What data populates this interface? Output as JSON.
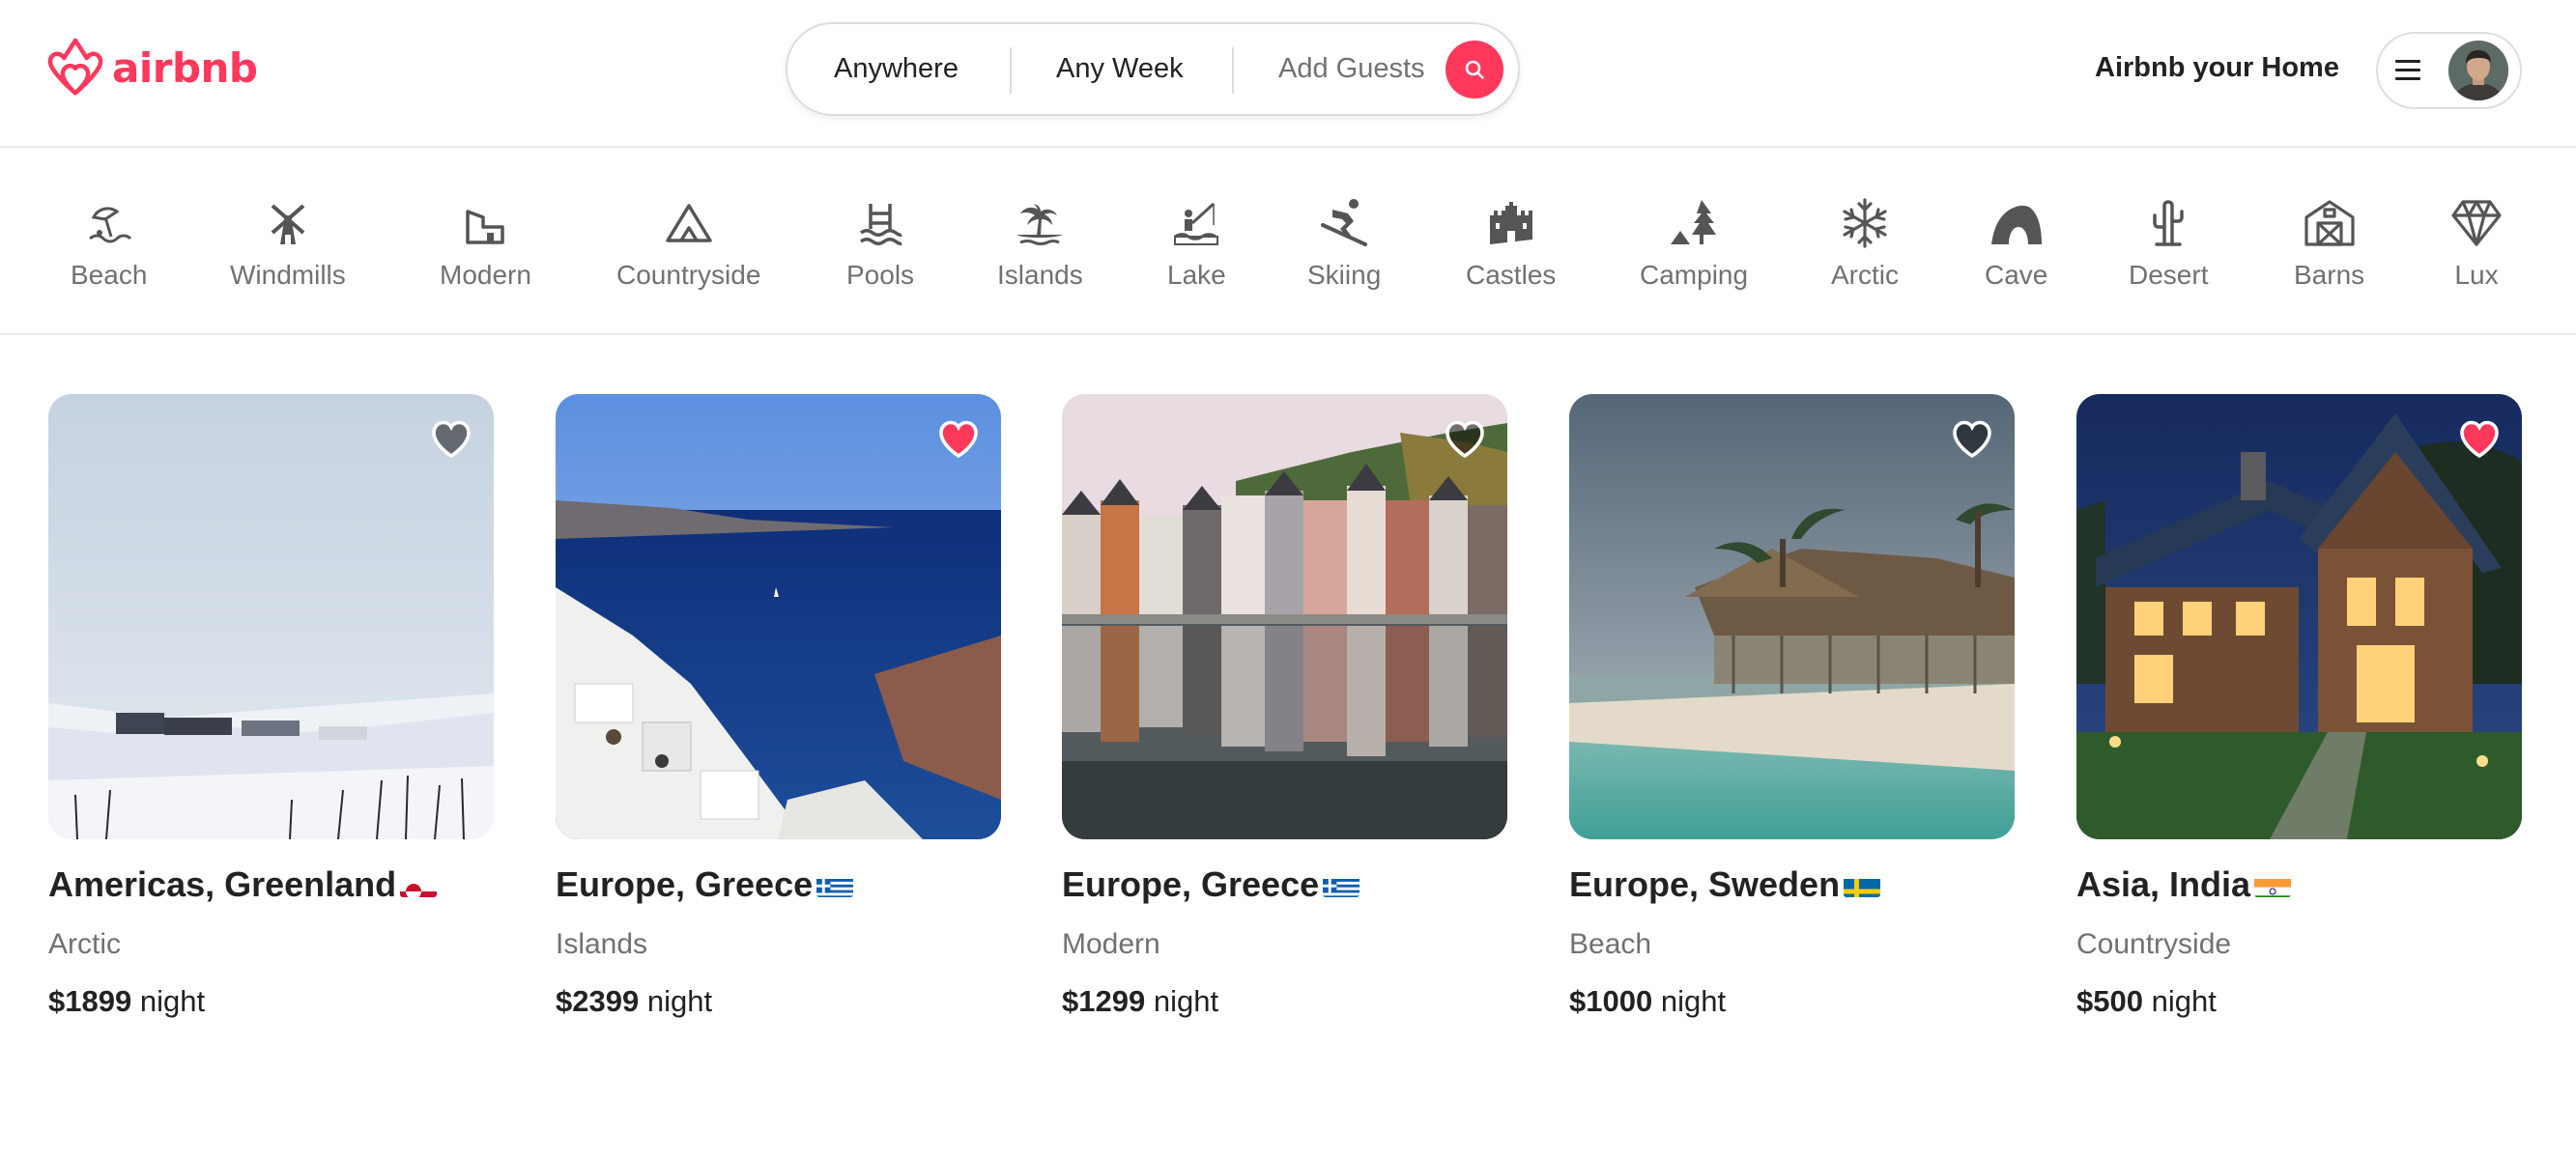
{
  "brand": {
    "name": "airbnb",
    "color": "#ff385c",
    "logo_icon": "airbnb-belo-icon"
  },
  "search": {
    "where": "Anywhere",
    "when": "Any Week",
    "guests": "Add Guests",
    "button_icon": "search-icon"
  },
  "header": {
    "host_link": "Airbnb your Home",
    "menu_icon": "hamburger-menu-icon",
    "avatar": "user-avatar"
  },
  "categories": [
    {
      "label": "Beach",
      "icon": "beach-icon"
    },
    {
      "label": "Windmills",
      "icon": "windmill-icon"
    },
    {
      "label": "Modern",
      "icon": "modern-house-icon"
    },
    {
      "label": "Countryside",
      "icon": "mountain-icon"
    },
    {
      "label": "Pools",
      "icon": "pool-icon"
    },
    {
      "label": "Islands",
      "icon": "island-icon"
    },
    {
      "label": "Lake",
      "icon": "lake-fishing-icon"
    },
    {
      "label": "Skiing",
      "icon": "skiing-icon"
    },
    {
      "label": "Castles",
      "icon": "castle-icon"
    },
    {
      "label": "Camping",
      "icon": "camping-icon"
    },
    {
      "label": "Arctic",
      "icon": "snowflake-icon"
    },
    {
      "label": "Cave",
      "icon": "cave-icon"
    },
    {
      "label": "Desert",
      "icon": "cactus-icon"
    },
    {
      "label": "Barns",
      "icon": "barn-icon"
    },
    {
      "label": "Lux",
      "icon": "diamond-icon"
    }
  ],
  "listings": [
    {
      "location": "Americas, Greenland",
      "flag": "greenland-flag",
      "category": "Arctic",
      "price": "$1899",
      "unit": "night",
      "favorited": false
    },
    {
      "location": "Europe, Greece",
      "flag": "greece-flag",
      "category": "Islands",
      "price": "$2399",
      "unit": "night",
      "favorited": true
    },
    {
      "location": "Europe, Greece",
      "flag": "greece-flag",
      "category": "Modern",
      "price": "$1299",
      "unit": "night",
      "favorited": false
    },
    {
      "location": "Europe, Sweden",
      "flag": "sweden-flag",
      "category": "Beach",
      "price": "$1000",
      "unit": "night",
      "favorited": false
    },
    {
      "location": "Asia, India",
      "flag": "india-flag",
      "category": "Countryside",
      "price": "$500",
      "unit": "night",
      "favorited": true
    }
  ],
  "colors": {
    "accent": "#ff385c",
    "heart_on": "#ff385c",
    "heart_off": "rgba(0,0,0,0.5)",
    "muted_text": "#717171"
  }
}
